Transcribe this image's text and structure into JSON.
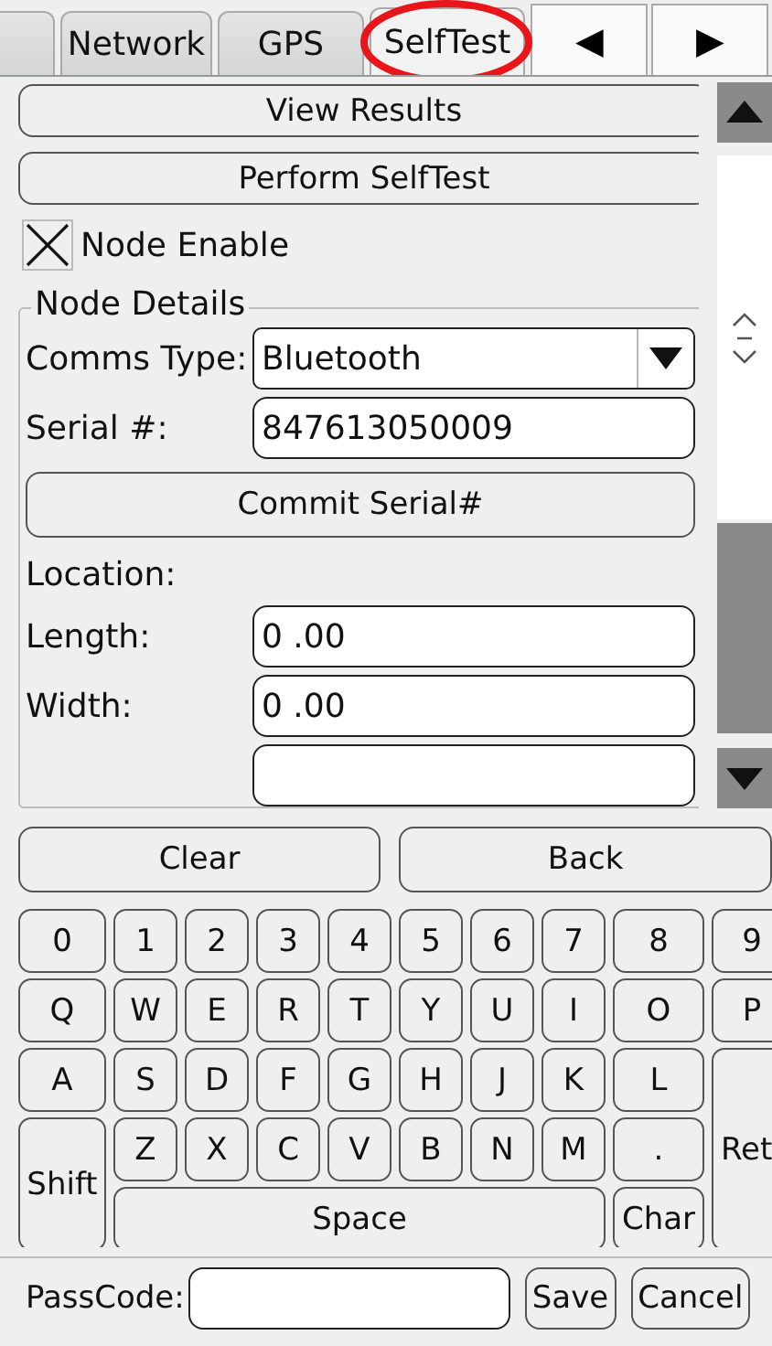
{
  "tabs": [
    {
      "selected": false
    },
    {
      "label": "Network",
      "selected": false
    },
    {
      "label": "GPS",
      "selected": false
    },
    {
      "label": "SelfTest",
      "selected": true,
      "circled": true
    }
  ],
  "tab_scroll": {
    "left": "◀",
    "right": "▶"
  },
  "form": {
    "buttons": [
      "View Results",
      "Perform SelfTest"
    ],
    "node_enable": {
      "label": "Node Enable",
      "checked": true
    },
    "group": {
      "title": "Node Details",
      "comms_type": {
        "label": "Comms Type:",
        "value": "Bluetooth"
      },
      "serial": {
        "label": "Serial #:",
        "value": "847613050009"
      },
      "commit_button": "Commit Serial#",
      "location_label": "Location:",
      "fields": [
        {
          "kind": "field",
          "label": "Length:",
          "value": "0 .00"
        },
        {
          "kind": "field",
          "label": "Width:",
          "value": "0 .00"
        },
        {
          "kind": "clipped"
        }
      ]
    }
  },
  "keyboard": {
    "top": [
      "Clear",
      "Back"
    ],
    "keys": [
      "0",
      "1",
      "2",
      "3",
      "4",
      "5",
      "6",
      "7",
      "8",
      "9",
      "Q",
      "W",
      "E",
      "R",
      "T",
      "Y",
      "U",
      "I",
      "O",
      "P",
      "A",
      "S",
      "D",
      "F",
      "G",
      "H",
      "J",
      "K",
      "L",
      "Shift",
      "Z",
      "X",
      "C",
      "V",
      "B",
      "N",
      "M",
      ".",
      "Ret",
      "Space",
      "Char"
    ]
  },
  "passcode": {
    "label": "PassCode:",
    "buttons": [
      "Save",
      "Cancel"
    ]
  }
}
